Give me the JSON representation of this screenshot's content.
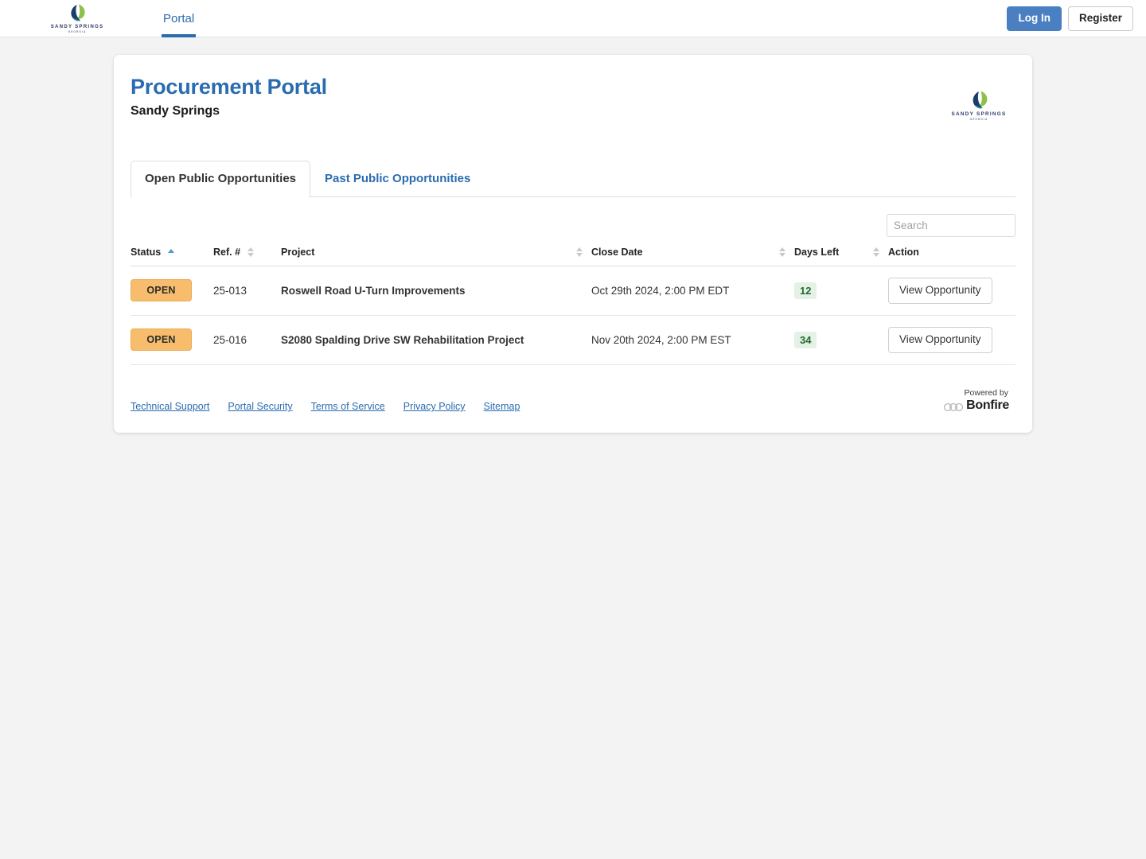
{
  "navbar": {
    "logo": {
      "icon": "sandy-springs-leaf-logo",
      "wordmark": "SANDY SPRINGS",
      "submark": "GEORGIA"
    },
    "links": [
      {
        "label": "Portal",
        "active": true
      }
    ],
    "login_label": "Log In",
    "register_label": "Register"
  },
  "header": {
    "title": "Procurement Portal",
    "subtitle": "Sandy Springs",
    "logo": {
      "icon": "sandy-springs-leaf-logo",
      "wordmark": "SANDY SPRINGS",
      "submark": "GEORGIA"
    }
  },
  "tabs": [
    {
      "label": "Open Public Opportunities",
      "active": true
    },
    {
      "label": "Past Public Opportunities",
      "active": false
    }
  ],
  "search": {
    "placeholder": "Search",
    "value": ""
  },
  "table": {
    "columns": [
      {
        "label": "Status",
        "sortable": true,
        "sort": "asc"
      },
      {
        "label": "Ref. #",
        "sortable": true,
        "sort": "none"
      },
      {
        "label": "Project",
        "sortable": true,
        "sort": "none"
      },
      {
        "label": "Close Date",
        "sortable": true,
        "sort": "none"
      },
      {
        "label": "Days Left",
        "sortable": true,
        "sort": "none"
      },
      {
        "label": "Action",
        "sortable": false,
        "sort": "none"
      }
    ],
    "rows": [
      {
        "status": "OPEN",
        "ref": "25-013",
        "project": "Roswell Road U-Turn Improvements",
        "close_date": "Oct 29th 2024, 2:00 PM EDT",
        "days_left": "12",
        "action_label": "View Opportunity"
      },
      {
        "status": "OPEN",
        "ref": "25-016",
        "project": "S2080 Spalding Drive SW Rehabilitation Project",
        "close_date": "Nov 20th 2024, 2:00 PM EST",
        "days_left": "34",
        "action_label": "View Opportunity"
      }
    ]
  },
  "footer": {
    "links": [
      {
        "label": "Technical Support"
      },
      {
        "label": "Portal Security"
      },
      {
        "label": "Terms of Service"
      },
      {
        "label": "Privacy Policy"
      },
      {
        "label": "Sitemap"
      }
    ],
    "powered_by_label": "Powered by",
    "powered_by_brand": "Bonfire",
    "powered_by_icon": "binoculars-icon"
  },
  "colors": {
    "accent_blue": "#2a6cb0",
    "login_button": "#4a7fc1",
    "status_open_bg": "#f7bd6d",
    "days_left_bg": "#e6f1e6",
    "days_left_text": "#1f6b32",
    "page_bg": "#f3f3f3"
  }
}
